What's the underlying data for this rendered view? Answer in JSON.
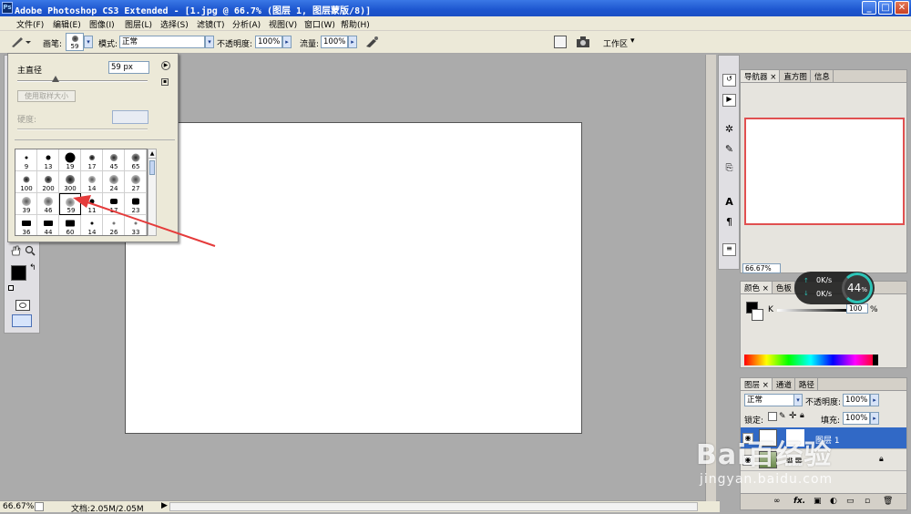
{
  "window": {
    "title": "Adobe Photoshop CS3 Extended - [1.jpg @ 66.7% (图层 1, 图层蒙版/8)]",
    "app_icon": "Ps",
    "btn_min": "_",
    "btn_max": "□",
    "btn_close": "✕"
  },
  "menubar": {
    "items": [
      "文件(F)",
      "编辑(E)",
      "图像(I)",
      "图层(L)",
      "选择(S)",
      "滤镜(T)",
      "分析(A)",
      "视图(V)",
      "窗口(W)",
      "帮助(H)"
    ]
  },
  "options_bar": {
    "brush_label": "画笔:",
    "brush_size_value": "59",
    "mode_label": "模式:",
    "mode_value": "正常",
    "opacity_label": "不透明度:",
    "opacity_value": "100%",
    "flow_label": "流量:",
    "flow_value": "100%",
    "workspace_label": "工作区"
  },
  "brush_popup": {
    "diameter_label": "主直径",
    "diameter_value": "59 px",
    "sample_button": "使用取样大小",
    "hardness_label": "硬度:",
    "presets": [
      "9",
      "13",
      "19",
      "17",
      "45",
      "65",
      "100",
      "200",
      "300",
      "14",
      "24",
      "27",
      "39",
      "46",
      "59",
      "11",
      "17",
      "23",
      "36",
      "44",
      "60",
      "14",
      "26",
      "33"
    ]
  },
  "statusbar": {
    "zoom": "66.67%",
    "doc_info": "文档:2.05M/2.05M"
  },
  "navigator_panel": {
    "tabs": [
      "导航器",
      "直方图",
      "信息"
    ],
    "zoom": "66.67%"
  },
  "color_panel": {
    "tabs": [
      "颜色",
      "色板"
    ],
    "channel_label": "K",
    "channel_value": "100",
    "unit": "%"
  },
  "layers_panel": {
    "tabs": [
      "图层",
      "通道",
      "路径"
    ],
    "blend_mode": "正常",
    "opacity_label": "不透明度:",
    "opacity_value": "100%",
    "lock_label": "锁定:",
    "fill_label": "填充:",
    "fill_value": "100%",
    "layers": [
      "图层 1",
      "背景"
    ],
    "footer_icons": [
      "link-icon",
      "fx-icon",
      "mask-icon",
      "adjustment-icon",
      "group-icon",
      "new-layer-icon",
      "trash-icon"
    ]
  },
  "net_monitor": {
    "up": "0K/s",
    "down": "0K/s",
    "percent": "44",
    "percent_unit": "%"
  },
  "watermark": {
    "logo": "Bai百经验",
    "url": "jingyan.baidu.com"
  },
  "colors": {
    "accent_red_arrow": "#e53b3b",
    "titlebar_blue": "#1d56cf",
    "monitor_ring": "#2dc4b7"
  }
}
